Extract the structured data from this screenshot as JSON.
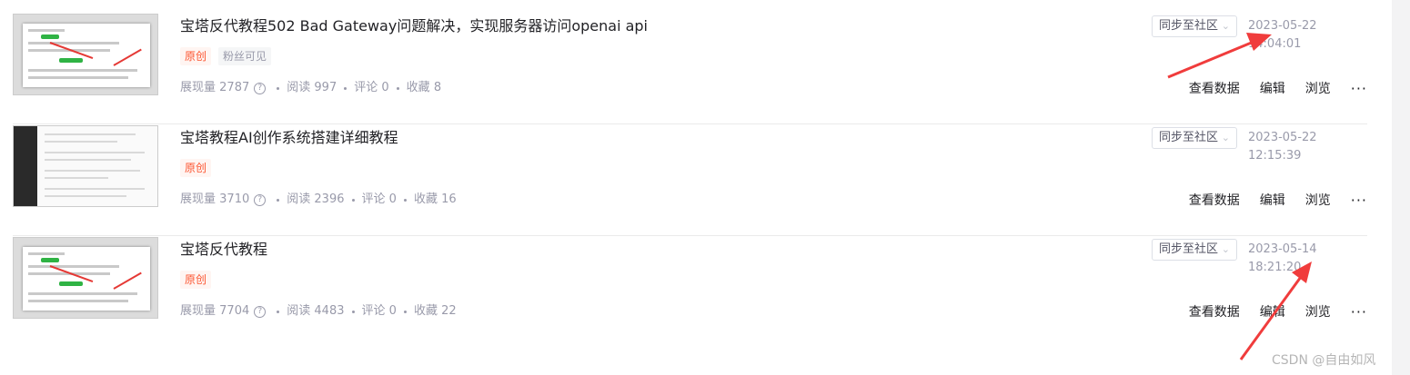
{
  "articles": [
    {
      "title": "宝塔反代教程502 Bad Gateway问题解决，实现服务器访问openai api",
      "tags": {
        "original": "原创",
        "fans_only": "粉丝可见"
      },
      "stats": {
        "views_label": "展现量",
        "views": "2787",
        "reads_label": "阅读",
        "reads": "997",
        "comments_label": "评论",
        "comments": "0",
        "favorites_label": "收藏",
        "favorites": "8"
      },
      "sync_label": "同步至社区",
      "time": "2023-05-22 14:04:01",
      "actions": {
        "data": "查看数据",
        "edit": "编辑",
        "browse": "浏览",
        "more": "···"
      }
    },
    {
      "title": "宝塔教程AI创作系统搭建详细教程",
      "tags": {
        "original": "原创"
      },
      "stats": {
        "views_label": "展现量",
        "views": "3710",
        "reads_label": "阅读",
        "reads": "2396",
        "comments_label": "评论",
        "comments": "0",
        "favorites_label": "收藏",
        "favorites": "16"
      },
      "sync_label": "同步至社区",
      "time": "2023-05-22 12:15:39",
      "actions": {
        "data": "查看数据",
        "edit": "编辑",
        "browse": "浏览",
        "more": "···"
      }
    },
    {
      "title": "宝塔反代教程",
      "tags": {
        "original": "原创"
      },
      "stats": {
        "views_label": "展现量",
        "views": "7704",
        "reads_label": "阅读",
        "reads": "4483",
        "comments_label": "评论",
        "comments": "0",
        "favorites_label": "收藏",
        "favorites": "22"
      },
      "sync_label": "同步至社区",
      "time": "2023-05-14 18:21:20",
      "actions": {
        "data": "查看数据",
        "edit": "编辑",
        "browse": "浏览",
        "more": "···"
      }
    }
  ],
  "watermark": "CSDN @自由如风",
  "colors": {
    "tag_original": "#fc5531",
    "annotation_arrow": "#f03c3c",
    "meta_text": "#999aaa"
  },
  "icons": {
    "help": "help-circle-icon",
    "sync_dropdown": "chevron-down-icon",
    "more": "more-dots-icon"
  }
}
